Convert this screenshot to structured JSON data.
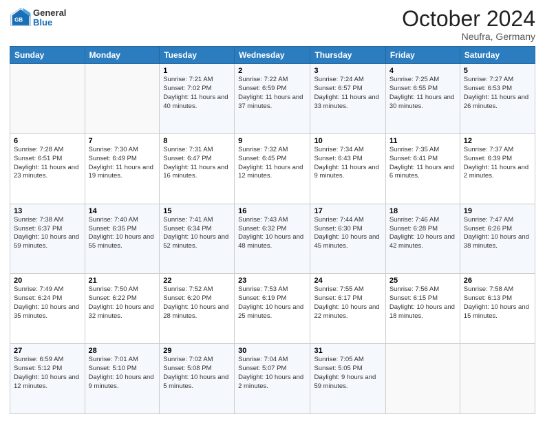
{
  "header": {
    "logo": {
      "general": "General",
      "blue": "Blue"
    },
    "month": "October 2024",
    "location": "Neufra, Germany"
  },
  "weekdays": [
    "Sunday",
    "Monday",
    "Tuesday",
    "Wednesday",
    "Thursday",
    "Friday",
    "Saturday"
  ],
  "weeks": [
    [
      {
        "day": "",
        "info": ""
      },
      {
        "day": "",
        "info": ""
      },
      {
        "day": "1",
        "info": "Sunrise: 7:21 AM\nSunset: 7:02 PM\nDaylight: 11 hours and 40 minutes."
      },
      {
        "day": "2",
        "info": "Sunrise: 7:22 AM\nSunset: 6:59 PM\nDaylight: 11 hours and 37 minutes."
      },
      {
        "day": "3",
        "info": "Sunrise: 7:24 AM\nSunset: 6:57 PM\nDaylight: 11 hours and 33 minutes."
      },
      {
        "day": "4",
        "info": "Sunrise: 7:25 AM\nSunset: 6:55 PM\nDaylight: 11 hours and 30 minutes."
      },
      {
        "day": "5",
        "info": "Sunrise: 7:27 AM\nSunset: 6:53 PM\nDaylight: 11 hours and 26 minutes."
      }
    ],
    [
      {
        "day": "6",
        "info": "Sunrise: 7:28 AM\nSunset: 6:51 PM\nDaylight: 11 hours and 23 minutes."
      },
      {
        "day": "7",
        "info": "Sunrise: 7:30 AM\nSunset: 6:49 PM\nDaylight: 11 hours and 19 minutes."
      },
      {
        "day": "8",
        "info": "Sunrise: 7:31 AM\nSunset: 6:47 PM\nDaylight: 11 hours and 16 minutes."
      },
      {
        "day": "9",
        "info": "Sunrise: 7:32 AM\nSunset: 6:45 PM\nDaylight: 11 hours and 12 minutes."
      },
      {
        "day": "10",
        "info": "Sunrise: 7:34 AM\nSunset: 6:43 PM\nDaylight: 11 hours and 9 minutes."
      },
      {
        "day": "11",
        "info": "Sunrise: 7:35 AM\nSunset: 6:41 PM\nDaylight: 11 hours and 6 minutes."
      },
      {
        "day": "12",
        "info": "Sunrise: 7:37 AM\nSunset: 6:39 PM\nDaylight: 11 hours and 2 minutes."
      }
    ],
    [
      {
        "day": "13",
        "info": "Sunrise: 7:38 AM\nSunset: 6:37 PM\nDaylight: 10 hours and 59 minutes."
      },
      {
        "day": "14",
        "info": "Sunrise: 7:40 AM\nSunset: 6:35 PM\nDaylight: 10 hours and 55 minutes."
      },
      {
        "day": "15",
        "info": "Sunrise: 7:41 AM\nSunset: 6:34 PM\nDaylight: 10 hours and 52 minutes."
      },
      {
        "day": "16",
        "info": "Sunrise: 7:43 AM\nSunset: 6:32 PM\nDaylight: 10 hours and 48 minutes."
      },
      {
        "day": "17",
        "info": "Sunrise: 7:44 AM\nSunset: 6:30 PM\nDaylight: 10 hours and 45 minutes."
      },
      {
        "day": "18",
        "info": "Sunrise: 7:46 AM\nSunset: 6:28 PM\nDaylight: 10 hours and 42 minutes."
      },
      {
        "day": "19",
        "info": "Sunrise: 7:47 AM\nSunset: 6:26 PM\nDaylight: 10 hours and 38 minutes."
      }
    ],
    [
      {
        "day": "20",
        "info": "Sunrise: 7:49 AM\nSunset: 6:24 PM\nDaylight: 10 hours and 35 minutes."
      },
      {
        "day": "21",
        "info": "Sunrise: 7:50 AM\nSunset: 6:22 PM\nDaylight: 10 hours and 32 minutes."
      },
      {
        "day": "22",
        "info": "Sunrise: 7:52 AM\nSunset: 6:20 PM\nDaylight: 10 hours and 28 minutes."
      },
      {
        "day": "23",
        "info": "Sunrise: 7:53 AM\nSunset: 6:19 PM\nDaylight: 10 hours and 25 minutes."
      },
      {
        "day": "24",
        "info": "Sunrise: 7:55 AM\nSunset: 6:17 PM\nDaylight: 10 hours and 22 minutes."
      },
      {
        "day": "25",
        "info": "Sunrise: 7:56 AM\nSunset: 6:15 PM\nDaylight: 10 hours and 18 minutes."
      },
      {
        "day": "26",
        "info": "Sunrise: 7:58 AM\nSunset: 6:13 PM\nDaylight: 10 hours and 15 minutes."
      }
    ],
    [
      {
        "day": "27",
        "info": "Sunrise: 6:59 AM\nSunset: 5:12 PM\nDaylight: 10 hours and 12 minutes."
      },
      {
        "day": "28",
        "info": "Sunrise: 7:01 AM\nSunset: 5:10 PM\nDaylight: 10 hours and 9 minutes."
      },
      {
        "day": "29",
        "info": "Sunrise: 7:02 AM\nSunset: 5:08 PM\nDaylight: 10 hours and 5 minutes."
      },
      {
        "day": "30",
        "info": "Sunrise: 7:04 AM\nSunset: 5:07 PM\nDaylight: 10 hours and 2 minutes."
      },
      {
        "day": "31",
        "info": "Sunrise: 7:05 AM\nSunset: 5:05 PM\nDaylight: 9 hours and 59 minutes."
      },
      {
        "day": "",
        "info": ""
      },
      {
        "day": "",
        "info": ""
      }
    ]
  ]
}
